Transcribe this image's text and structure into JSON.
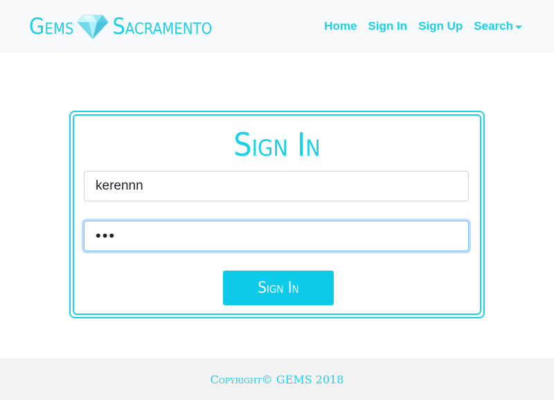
{
  "colors": {
    "accent": "#1ad1e6",
    "button_bg": "#0ecbe9",
    "navbar_bg": "#f8f9fa",
    "footer_bg": "#f2f2f2",
    "focus_border": "#80bdff"
  },
  "navbar": {
    "brand_left": "Gems",
    "brand_icon": "diamond-icon",
    "brand_right": "Sacramento",
    "links": [
      {
        "label": "Home"
      },
      {
        "label": "Sign In"
      },
      {
        "label": "Sign Up"
      },
      {
        "label": "Search",
        "has_dropdown": true
      }
    ]
  },
  "signin_form": {
    "title": "Sign In",
    "username_value": "kerennn",
    "password_display": "•••",
    "submit_label": "Sign In"
  },
  "footer": {
    "text": "Copyright© GEMS 2018"
  }
}
